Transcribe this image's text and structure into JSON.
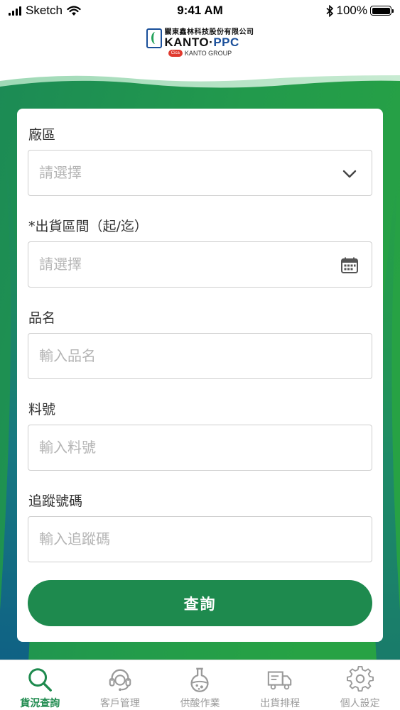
{
  "status_bar": {
    "carrier": "Sketch",
    "time": "9:41 AM",
    "battery": "100%"
  },
  "header": {
    "company_cn": "關東鑫林科技股份有限公司",
    "logo_kanto": "KANTO",
    "logo_dot": "·",
    "logo_ppc": "PPC",
    "group_badge": "Cica",
    "group_name": "KANTO GROUP"
  },
  "form": {
    "plant": {
      "label": "廠區",
      "placeholder": "請選擇",
      "icon": "chevron-down-icon"
    },
    "ship_period": {
      "required_mark": "*",
      "label": "出貨區間（起/迄）",
      "placeholder": "請選擇",
      "icon": "calendar-icon"
    },
    "product_name": {
      "label": "品名",
      "placeholder": "輸入品名"
    },
    "part_number": {
      "label": "料號",
      "placeholder": "輸入料號"
    },
    "tracking_number": {
      "label": "追蹤號碼",
      "placeholder": "輸入追蹤碼"
    },
    "submit_label": "查詢"
  },
  "tabbar": {
    "items": [
      {
        "label": "貨況查詢",
        "icon": "search-icon",
        "active": true
      },
      {
        "label": "客戶管理",
        "icon": "headset-icon",
        "active": false
      },
      {
        "label": "供酸作業",
        "icon": "flask-icon",
        "active": false
      },
      {
        "label": "出貨排程",
        "icon": "truck-icon",
        "active": false
      },
      {
        "label": "個人設定",
        "icon": "gear-icon",
        "active": false
      }
    ]
  },
  "colors": {
    "brand_green": "#1e8a4e",
    "brand_teal": "#146f80",
    "logo_blue": "#1a4f9a",
    "inactive_gray": "#9a9a9a"
  }
}
